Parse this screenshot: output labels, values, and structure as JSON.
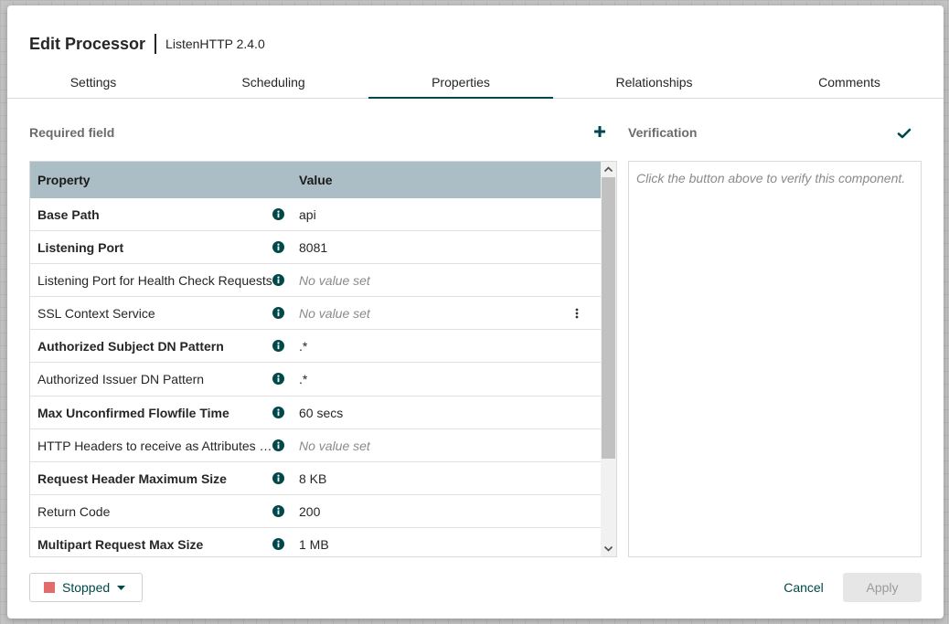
{
  "dialog": {
    "title": "Edit Processor",
    "subtitle": "ListenHTTP 2.4.0"
  },
  "tabs": [
    {
      "label": "Settings"
    },
    {
      "label": "Scheduling"
    },
    {
      "label": "Properties",
      "active": true
    },
    {
      "label": "Relationships"
    },
    {
      "label": "Comments"
    }
  ],
  "properties": {
    "section_label": "Required field",
    "add_icon": "plus-icon",
    "columns": {
      "property": "Property",
      "value": "Value"
    },
    "rows": [
      {
        "name": "Base Path",
        "value": "api",
        "required": true
      },
      {
        "name": "Listening Port",
        "value": "8081",
        "required": true
      },
      {
        "name": "Listening Port for Health Check Requests",
        "value": "No value set",
        "required": false,
        "empty": true
      },
      {
        "name": "SSL Context Service",
        "value": "No value set",
        "required": false,
        "empty": true,
        "has_menu": true
      },
      {
        "name": "Authorized Subject DN Pattern",
        "value": ".*",
        "required": true
      },
      {
        "name": "Authorized Issuer DN Pattern",
        "value": ".*",
        "required": false
      },
      {
        "name": "Max Unconfirmed Flowfile Time",
        "value": "60 secs",
        "required": true
      },
      {
        "name": "HTTP Headers to receive as Attributes (Regex)",
        "value": "No value set",
        "required": false,
        "empty": true
      },
      {
        "name": "Request Header Maximum Size",
        "value": "8 KB",
        "required": true
      },
      {
        "name": "Return Code",
        "value": "200",
        "required": false
      },
      {
        "name": "Multipart Request Max Size",
        "value": "1 MB",
        "required": true
      }
    ]
  },
  "verification": {
    "label": "Verification",
    "placeholder": "Click the button above to verify this component.",
    "verify_icon": "checkmark-icon"
  },
  "footer": {
    "status_label": "Stopped",
    "status_color": "#e36b6b",
    "cancel_label": "Cancel",
    "apply_label": "Apply"
  },
  "colors": {
    "accent": "#004849",
    "table_header": "#abbdc5"
  }
}
